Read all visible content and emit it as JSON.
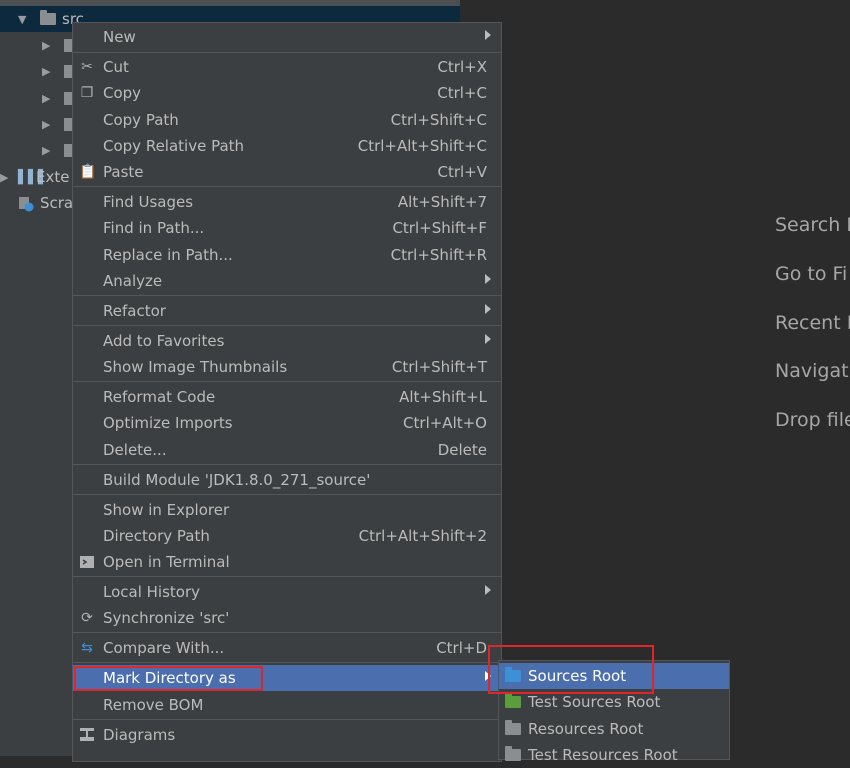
{
  "project_tree": {
    "root_label": "src",
    "external_label": "Exte",
    "scratch_label": "Scra"
  },
  "editor_hints": [
    "Search E",
    "Go to Fi",
    "Recent F",
    "Navigat",
    "Drop file"
  ],
  "context_menu": {
    "items": [
      {
        "label": "New",
        "submenu": true
      },
      {
        "label": "Cut",
        "shortcut": "Ctrl+X",
        "icon": "scissors-icon"
      },
      {
        "label": "Copy",
        "shortcut": "Ctrl+C",
        "icon": "copy-icon"
      },
      {
        "label": "Copy Path",
        "shortcut": "Ctrl+Shift+C"
      },
      {
        "label": "Copy Relative Path",
        "shortcut": "Ctrl+Alt+Shift+C"
      },
      {
        "label": "Paste",
        "shortcut": "Ctrl+V",
        "icon": "clipboard-icon"
      },
      {
        "label": "Find Usages",
        "shortcut": "Alt+Shift+7"
      },
      {
        "label": "Find in Path...",
        "shortcut": "Ctrl+Shift+F"
      },
      {
        "label": "Replace in Path...",
        "shortcut": "Ctrl+Shift+R"
      },
      {
        "label": "Analyze",
        "submenu": true
      },
      {
        "label": "Refactor",
        "submenu": true
      },
      {
        "label": "Add to Favorites",
        "submenu": true
      },
      {
        "label": "Show Image Thumbnails",
        "shortcut": "Ctrl+Shift+T"
      },
      {
        "label": "Reformat Code",
        "shortcut": "Alt+Shift+L"
      },
      {
        "label": "Optimize Imports",
        "shortcut": "Ctrl+Alt+O"
      },
      {
        "label": "Delete...",
        "shortcut": "Delete"
      },
      {
        "label": "Build Module 'JDK1.8.0_271_source'"
      },
      {
        "label": "Show in Explorer"
      },
      {
        "label": "Directory Path",
        "shortcut": "Ctrl+Alt+Shift+2"
      },
      {
        "label": "Open in Terminal",
        "icon": "terminal-icon"
      },
      {
        "label": "Local History",
        "submenu": true
      },
      {
        "label": "Synchronize 'src'",
        "icon": "sync-icon"
      },
      {
        "label": "Compare With...",
        "shortcut": "Ctrl+D",
        "icon": "compare-icon"
      },
      {
        "label": "Mark Directory as",
        "submenu": true,
        "highlighted": true
      },
      {
        "label": "Remove BOM"
      },
      {
        "label": "Diagrams",
        "submenu": true,
        "icon": "diagram-icon"
      }
    ]
  },
  "submenu": {
    "items": [
      {
        "label": "Sources Root",
        "color": "#3d8fd6",
        "highlighted": true
      },
      {
        "label": "Test Sources Root",
        "color": "#5a9e3b"
      },
      {
        "label": "Resources Root",
        "color": "#8a8e91"
      },
      {
        "label": "Test Resources Root",
        "color": "#8a8e91"
      }
    ]
  },
  "colors": {
    "menu_bg": "#3c3f41",
    "highlight": "#4b6eaf",
    "annotation_red": "#e0262b"
  }
}
